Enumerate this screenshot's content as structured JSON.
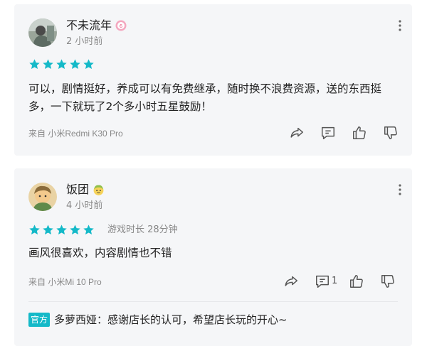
{
  "colors": {
    "star": "#14b9c8",
    "official_tag_bg": "#14b9c8",
    "card_bg": "#f5f6f8",
    "muted_text": "#888888"
  },
  "reviews": [
    {
      "username": "不未流年",
      "badge_icon": "pink-badge-icon",
      "time": "2 小时前",
      "rating": 5,
      "content": "可以，剧情挺好，养成可以有免费继承，随时换不浪费资源，送的东西挺多，一下就玩了2个多小时五星鼓励！",
      "device": "来自 小米Redmi K30 Pro",
      "actions": [
        "share-icon",
        "comment-icon",
        "thumbs-up-icon",
        "thumbs-down-icon"
      ]
    },
    {
      "username": "饭团",
      "badge_icon": "emoji-badge-icon",
      "time": "4 小时前",
      "rating": 5,
      "playtime": "游戏时长 28分钟",
      "content": "画风很喜欢，内容剧情也不错",
      "device": "来自 小米Mi 10 Pro",
      "comment_count": "1",
      "actions": [
        "share-icon",
        "comment-icon",
        "thumbs-up-icon",
        "thumbs-down-icon"
      ],
      "official_reply": {
        "tag": "官方",
        "developer": "多萝西娅",
        "separator": "：",
        "text": "感谢店长的认可，希望店长玩的开心~"
      }
    }
  ]
}
